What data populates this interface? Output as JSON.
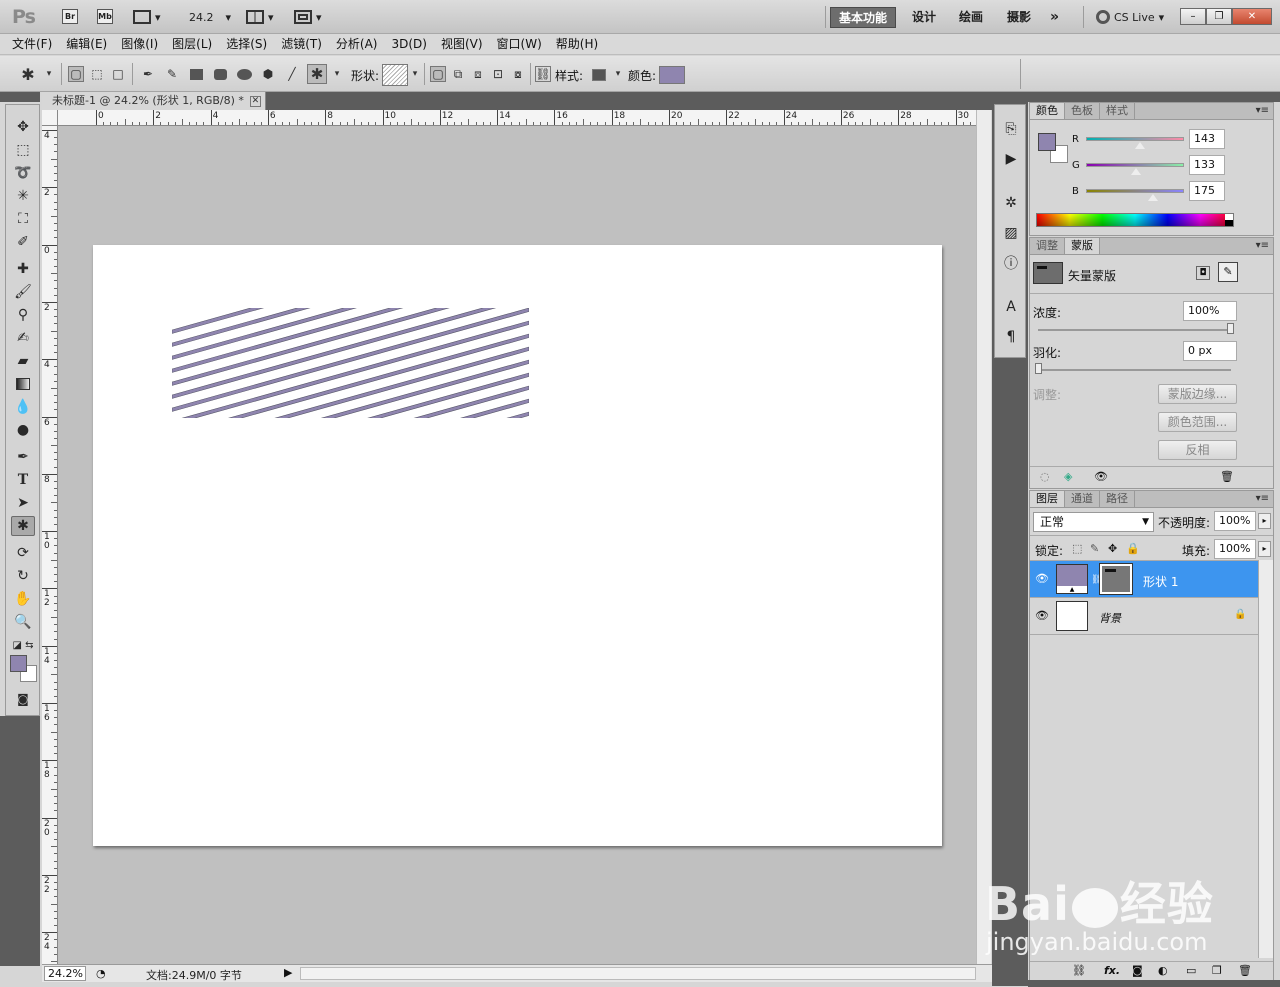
{
  "app": {
    "logo": "Ps",
    "apps": [
      "Br",
      "Mb"
    ],
    "zoom_value": "24.2",
    "workspaces": [
      "基本功能",
      "设计",
      "绘画",
      "摄影"
    ],
    "more": "»",
    "cs_live": "CS Live",
    "window_buttons": [
      "–",
      "❐",
      "✕"
    ]
  },
  "menu": [
    "文件(F)",
    "编辑(E)",
    "图像(I)",
    "图层(L)",
    "选择(S)",
    "滤镜(T)",
    "分析(A)",
    "3D(D)",
    "视图(V)",
    "窗口(W)",
    "帮助(H)"
  ],
  "options": {
    "shape_label": "形状:",
    "style_label": "样式:",
    "color_label": "颜色:",
    "color": "#8f85af"
  },
  "document": {
    "tab_title": "未标题-1 @ 24.2% (形状 1, RGB/8) *",
    "close": "✕",
    "ruler_top": [
      "0",
      "2",
      "4",
      "6",
      "8",
      "10",
      "12",
      "14",
      "16",
      "18",
      "20",
      "22",
      "24",
      "26",
      "28",
      "30"
    ],
    "ruler_left": [
      "4",
      "2",
      "0",
      "2",
      "4",
      "6",
      "8",
      "10",
      "12",
      "14",
      "16",
      "18",
      "20",
      "22",
      "24"
    ],
    "stripe_color": "#8f85af",
    "zoom_status": "24.2%",
    "doc_info": "文档:24.9M/0 字节"
  },
  "color_panel": {
    "tabs": [
      "颜色",
      "色板",
      "样式"
    ],
    "r_label": "R",
    "g_label": "G",
    "b_label": "B",
    "r": "143",
    "g": "133",
    "b": "175",
    "fg": "#8f85af",
    "bg": "#ffffff"
  },
  "mask_panel": {
    "tabs": [
      "调整",
      "蒙版"
    ],
    "title": "矢量蒙版",
    "density_label": "浓度:",
    "density_value": "100%",
    "feather_label": "羽化:",
    "feather_value": "0 px",
    "refine_label": "调整:",
    "btn_edge": "蒙版边缘...",
    "btn_range": "颜色范围...",
    "btn_invert": "反相"
  },
  "layers_panel": {
    "tabs": [
      "图层",
      "通道",
      "路径"
    ],
    "blend_mode": "正常",
    "opacity_label": "不透明度:",
    "opacity_value": "100%",
    "lock_label": "锁定:",
    "fill_label": "填充:",
    "fill_value": "100%",
    "layers": [
      {
        "name": "形状 1",
        "selected": true
      },
      {
        "name": "背景",
        "selected": false
      }
    ],
    "footer_icons": [
      "link-icon",
      "fx-icon",
      "mask-icon",
      "adjustment-icon",
      "group-icon",
      "new-layer-icon",
      "trash-icon"
    ]
  },
  "watermark": {
    "brand": "Bai 经验",
    "url": "jingyan.baidu.com"
  }
}
